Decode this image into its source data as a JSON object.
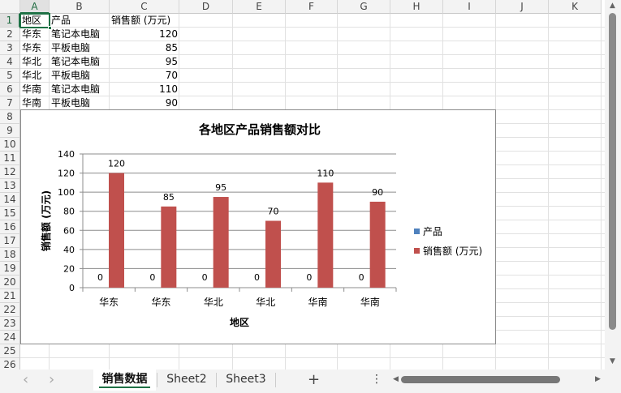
{
  "columns": [
    "A",
    "B",
    "C",
    "D",
    "E",
    "F",
    "G",
    "H",
    "I",
    "J",
    "K"
  ],
  "rows": [
    "1",
    "2",
    "3",
    "4",
    "5",
    "6",
    "7",
    "8",
    "9",
    "10",
    "11",
    "12",
    "13",
    "14",
    "15",
    "16",
    "17",
    "18",
    "19",
    "20",
    "21",
    "22",
    "23",
    "24",
    "25",
    "26"
  ],
  "cells": [
    [
      "地区",
      "产品",
      "销售额 (万元)"
    ],
    [
      "华东",
      "笔记本电脑",
      "120"
    ],
    [
      "华东",
      "平板电脑",
      "85"
    ],
    [
      "华北",
      "笔记本电脑",
      "95"
    ],
    [
      "华北",
      "平板电脑",
      "70"
    ],
    [
      "华南",
      "笔记本电脑",
      "110"
    ],
    [
      "华南",
      "平板电脑",
      "90"
    ]
  ],
  "sheets": {
    "tabs": [
      "销售数据",
      "Sheet2",
      "Sheet3"
    ],
    "add": "+",
    "more": "⋮",
    "prev": "‹",
    "next": "›"
  },
  "chart_data": {
    "type": "bar",
    "title": "各地区产品销售额对比",
    "xlabel": "地区",
    "ylabel": "销售额 (万元)",
    "categories": [
      "华东",
      "华东",
      "华北",
      "华北",
      "华南",
      "华南"
    ],
    "ylim": [
      0,
      140
    ],
    "yticks": [
      "0",
      "20",
      "40",
      "60",
      "80",
      "100",
      "120",
      "140"
    ],
    "grid": true,
    "legend_position": "right",
    "series": [
      {
        "name": "产品",
        "color": "#4f81bd",
        "values": [
          0,
          0,
          0,
          0,
          0,
          0
        ],
        "labels": [
          "0",
          "0",
          "0",
          "0",
          "0",
          "0"
        ]
      },
      {
        "name": "销售额 (万元)",
        "color": "#c0504d",
        "values": [
          120,
          85,
          95,
          70,
          110,
          90
        ],
        "labels": [
          "120",
          "85",
          "95",
          "70",
          "110",
          "90"
        ]
      }
    ]
  }
}
